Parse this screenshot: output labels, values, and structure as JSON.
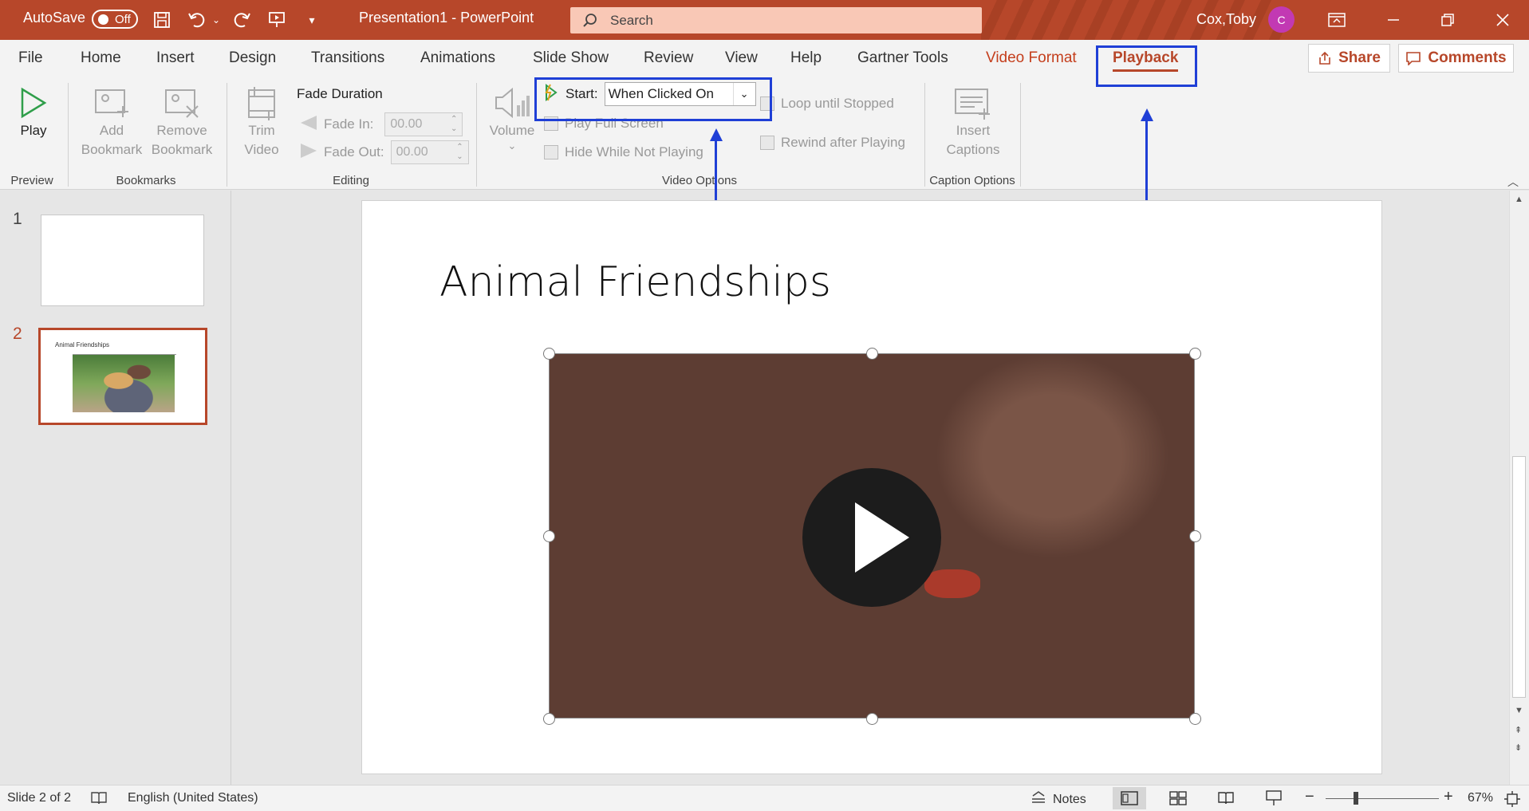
{
  "titlebar": {
    "autosave_label": "AutoSave",
    "autosave_state": "Off",
    "document_title": "Presentation1  -  PowerPoint",
    "search_placeholder": "Search",
    "user_name": "Cox,Toby",
    "user_initial": "C",
    "qat_icons": [
      "save-icon",
      "undo-icon",
      "redo-icon",
      "present-from-beginning-icon",
      "customize-qat-icon"
    ],
    "window_controls": [
      "ribbon-display-options-icon",
      "minimize-icon",
      "restore-icon",
      "close-icon"
    ]
  },
  "tabs": [
    {
      "label": "File"
    },
    {
      "label": "Home"
    },
    {
      "label": "Insert"
    },
    {
      "label": "Design"
    },
    {
      "label": "Transitions"
    },
    {
      "label": "Animations"
    },
    {
      "label": "Slide Show"
    },
    {
      "label": "Review"
    },
    {
      "label": "View"
    },
    {
      "label": "Help"
    },
    {
      "label": "Gartner Tools"
    },
    {
      "label": "Video Format"
    },
    {
      "label": "Playback"
    }
  ],
  "active_tab": "Playback",
  "share_label": "Share",
  "comments_label": "Comments",
  "ribbon": {
    "preview": {
      "group": "Preview",
      "play_label": "Play"
    },
    "bookmarks": {
      "group": "Bookmarks",
      "add_line1": "Add",
      "add_line2": "Bookmark",
      "remove_line1": "Remove",
      "remove_line2": "Bookmark"
    },
    "editing": {
      "group": "Editing",
      "trim_line1": "Trim",
      "trim_line2": "Video",
      "fade_duration": "Fade Duration",
      "fade_in_label": "Fade In:",
      "fade_in_value": "00.00",
      "fade_out_label": "Fade Out:",
      "fade_out_value": "00.00"
    },
    "video_options": {
      "group": "Video Options",
      "volume_label": "Volume",
      "start_label": "Start:",
      "start_value": "When Clicked On",
      "play_full_screen": "Play Full Screen",
      "hide_while_not_playing": "Hide While Not Playing",
      "loop_until_stopped": "Loop until Stopped",
      "rewind_after_playing": "Rewind after Playing"
    },
    "caption_options": {
      "group": "Caption Options",
      "insert_line1": "Insert",
      "insert_line2": "Captions"
    }
  },
  "slides": [
    {
      "number": "1",
      "title": ""
    },
    {
      "number": "2",
      "title": "Animal Friendships"
    }
  ],
  "current_slide": {
    "title": "Animal Friendships"
  },
  "status": {
    "slide_info": "Slide 2 of 2",
    "language": "English (United States)",
    "notes_label": "Notes",
    "zoom_minus": "−",
    "zoom_plus": "+",
    "zoom_level": "67%"
  },
  "accent_colors": {
    "brand": "#b7472a",
    "annotation": "#1f3fd6"
  }
}
